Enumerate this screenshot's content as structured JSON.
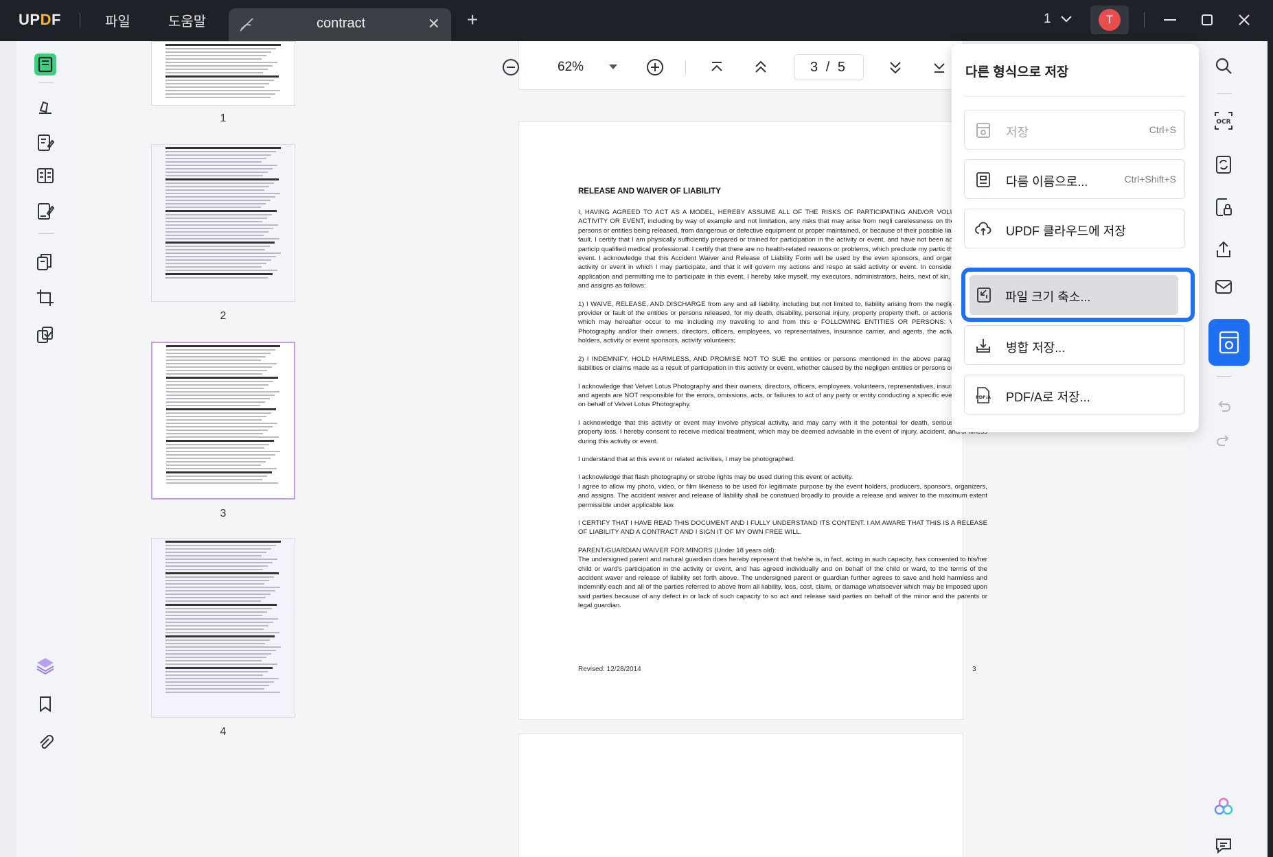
{
  "app": {
    "logo": {
      "part1": "UP",
      "part2": "D",
      "part3": "F"
    },
    "menu": [
      "파일",
      "도움말"
    ],
    "tab": {
      "label": "contract",
      "close": "✕"
    },
    "tab_add": "+",
    "page_count": "1",
    "avatar_initial": "T"
  },
  "navbar": {
    "zoom": "62%",
    "current_page": "3",
    "total_pages": "5",
    "separator": "/"
  },
  "thumbnails": [
    {
      "number": "1"
    },
    {
      "number": "2"
    },
    {
      "number": "3"
    },
    {
      "number": "4"
    }
  ],
  "document": {
    "title": "RELEASE AND WAIVER OF LIABILITY",
    "paragraphs": [
      "I, HAVING AGREED TO ACT AS A MODEL, HEREBY ASSUME ALL OF THE RISKS OF PARTICIPATING AND/OR VOLUN IN THIS ACTIVITY OR EVENT, including by way of example and not limitation, any risks that may arise from negli carelessness on the part of the persons or entities being released, from dangerous or defective equipment or proper maintained, or because of their possible liability without fault. I certify that I am physically sufficiently prepared or trained for participation in the activity or event, and have not been advised to not particip qualified medical professional. I certify that there are no health-related reasons or problems, which preclude my partic this activity or event. I acknowledge that this Accident Waiver and Release of Liability Form will be used by the even sponsors, and organizers of the activity or event in which I may participate, and that it will govern my actions and respo at said activity or event. In consideration of my application and permitting me to participate in this event, I hereby take myself, my executors, administrators, heirs, next of kin, successors, and assigns as follows:",
      "1) I WAIVE, RELEASE, AND DISCHARGE from any and all liability, including but not limited to, liability arising from the negligence of the provider or fault of the entities or persons released, for my death, disability, personal injury, property property theft, or actions of any kind which may hereafter occur to me including my traveling to and from this e FOLLOWING ENTITIES OR PERSONS: Velvet Lotus Photography and/or their owners, directors, officers, employees, vo representatives, insurance carrier, and agents, the activity or event holders, activity or event sponsors, activity volunteers;",
      "2) I INDEMNIFY, HOLD HARMLESS, AND PROMISE NOT TO SUE the entities or persons mentioned in the above parag any and all liabilities or claims made as a result of participation in this activity or event, whether caused by the negligen entities or persons or otherwise.",
      "I acknowledge that Velvet Lotus Photography and their owners, directors, officers, employees, volunteers, representatives, insurance carrier, and agents are NOT responsible for the errors, omissions, acts, or failures to act of any party or entity conducting a specific event or activity on behalf of Velvet Lotus Photography.",
      "I acknowledge that this activity or event may involve physical activity, and may carry with it the potential for death, serious injury, and property loss. I hereby consent to receive medical treatment, which may be deemed advisable in the event of injury, accident, and/or illness during this activity or event.",
      "I understand that at this event or related activities, I may be photographed.",
      "I acknowledge that flash photography or strobe lights may be used during this event or activity.\nI agree to allow my photo, video, or film likeness to be used for legitimate purpose by the event holders, producers, sponsors, organizers, and assigns. The accident waiver and release of liability shall be construed broadly to provide a release and waiver to the maximum extent permissible under applicable law.",
      "I CERTIFY THAT I HAVE READ THIS DOCUMENT AND I FULLY UNDERSTAND ITS CONTENT. I AM AWARE THAT THIS IS A RELEASE OF LIABILITY AND A CONTRACT AND I SIGN IT OF MY OWN FREE WILL.",
      "PARENT/GUARDIAN WAIVER FOR MINORS (Under 18 years old):\nThe undersigned parent and natural guardian does hereby represent that he/she is, in fact, acting in such capacity, has consented to his/her child or ward's participation in the activity or event, and has agreed individually and on behalf of the child or ward, to the terms of the accident waver and release of liability set forth above. The undersigned parent or guardian further agrees to save and hold harmless and indemnify each and all of the parties referred to above from all liability, loss, cost, claim, or damage whatsoever which may be imposed upon said parties because of any defect in or lack of such capacity to so act and release said parties on behalf of the minor and the parents or legal guardian."
    ],
    "footer_left": "Revised: 12/28/2014",
    "footer_right": "3"
  },
  "save_menu": {
    "title": "다른 형식으로 저장",
    "items": [
      {
        "label": "저장",
        "shortcut": "Ctrl+S",
        "icon": "save-icon",
        "disabled": true
      },
      {
        "label": "다름 이름으로...",
        "shortcut": "Ctrl+Shift+S",
        "icon": "save-as-icon"
      },
      {
        "label": "UPDF 클라우드에 저장",
        "shortcut": "",
        "icon": "cloud-upload-icon"
      },
      {
        "label": "파일 크기 축소...",
        "shortcut": "",
        "icon": "compress-icon",
        "highlighted": true
      },
      {
        "label": "병합 저장...",
        "shortcut": "",
        "icon": "download-tray-icon"
      },
      {
        "label": "PDF/A로 저장...",
        "shortcut": "",
        "icon": "pdfa-icon"
      }
    ],
    "pdfa_badge": "PDF/A"
  },
  "right_toolbar": {
    "ocr_label": "OCR"
  },
  "colors": {
    "titlebar": "#1e2127",
    "accent": "#1e6ff2",
    "avatar": "#e84e4e",
    "reader_green": "#3ccf7f",
    "thumb_selected": "#c79ae8"
  }
}
